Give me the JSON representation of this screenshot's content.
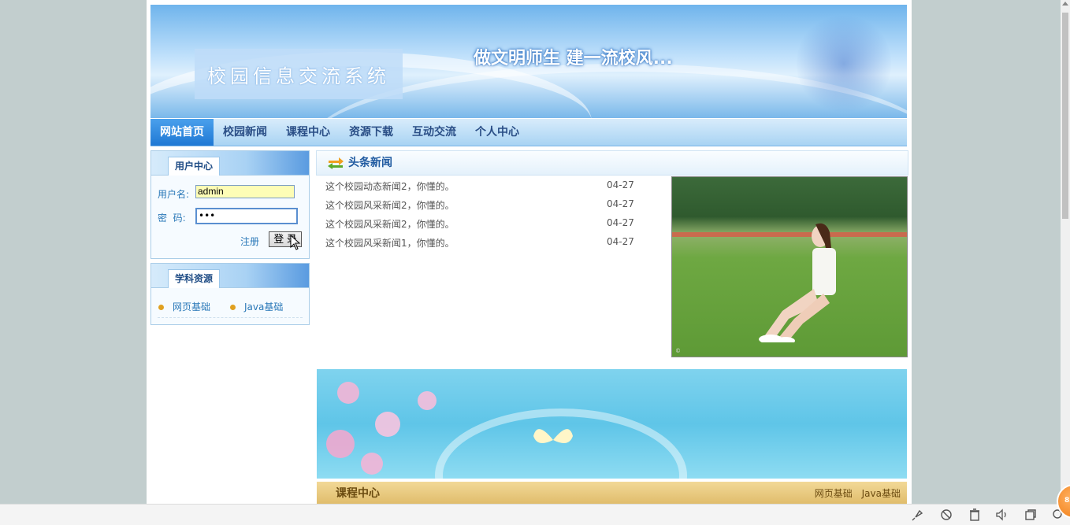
{
  "banner": {
    "site_title": "校园信息交流系统",
    "slogan": "做文明师生  建一流校风..."
  },
  "nav": {
    "items": [
      {
        "label": "网站首页",
        "active": true
      },
      {
        "label": "校园新闻"
      },
      {
        "label": "课程中心"
      },
      {
        "label": "资源下载"
      },
      {
        "label": "互动交流"
      },
      {
        "label": "个人中心"
      }
    ]
  },
  "user_center": {
    "title": "用户中心",
    "username_label": "用户名:",
    "username_value": "admin",
    "password_label": "密  码:",
    "password_value": "•••",
    "register_label": "注册",
    "login_label": "登 录"
  },
  "subjects": {
    "title": "学科资源",
    "items": [
      "网页基础",
      "Java基础"
    ]
  },
  "headline_news": {
    "title": "头条新闻",
    "items": [
      {
        "title": "这个校园动态新闻2，你懂的。",
        "date": "04-27"
      },
      {
        "title": "这个校园风采新闻2，你懂的。",
        "date": "04-27"
      },
      {
        "title": "这个校园风采新闻2，你懂的。",
        "date": "04-27"
      },
      {
        "title": "这个校园风采新闻1，你懂的。",
        "date": "04-27"
      }
    ]
  },
  "course_center": {
    "title": "课程中心",
    "links": [
      "网页基础",
      "Java基础"
    ]
  },
  "taskbar": {
    "notification_badge": "83"
  },
  "colors": {
    "nav_active": "#1f78d4",
    "link_blue": "#2a78b8",
    "course_bar": "#e0bd6c"
  }
}
